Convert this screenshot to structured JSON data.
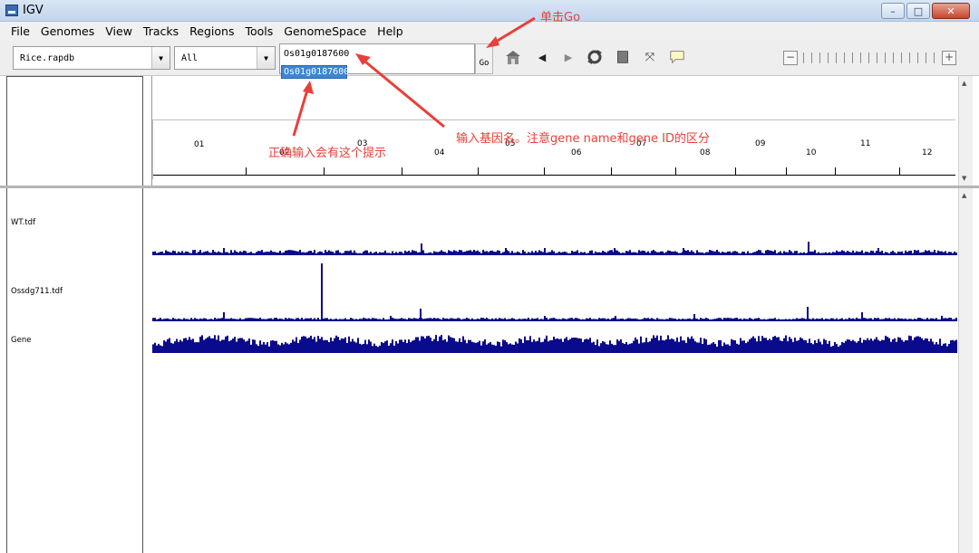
{
  "window": {
    "title": "IGV",
    "minimize_glyph": "–",
    "maximize_glyph": "□",
    "close_glyph": "✕"
  },
  "menu": [
    "File",
    "Genomes",
    "View",
    "Tracks",
    "Regions",
    "Tools",
    "GenomeSpace",
    "Help"
  ],
  "toolbar": {
    "genome": "Rice.rapdb",
    "chromosome": "All",
    "locus_value": "Os01g0187600",
    "locus_suggestion": "Os01g0187600",
    "go_label": "Go",
    "icons": [
      "home-icon",
      "back-icon",
      "forward-icon",
      "refresh-icon",
      "roi-icon",
      "resize-icon",
      "popup-text-icon"
    ],
    "zoom_minus": "−",
    "zoom_plus": "+"
  },
  "ruler": {
    "chromosomes": [
      "01",
      "02",
      "03",
      "04",
      "05",
      "06",
      "07",
      "08",
      "09",
      "10",
      "11",
      "12"
    ]
  },
  "tracks": [
    {
      "name": "WT.tdf"
    },
    {
      "name": "Ossdg711.tdf"
    },
    {
      "name": "Gene"
    }
  ],
  "annotations": {
    "click_go": "单击Go",
    "input_gene": "输入基因名。注意gene name和gene ID的区分",
    "correct_hint": "正确输入会有这个提示"
  },
  "colors": {
    "track": "#0a0a8c",
    "annotation": "#e8403a",
    "selection": "#3c86d4"
  }
}
